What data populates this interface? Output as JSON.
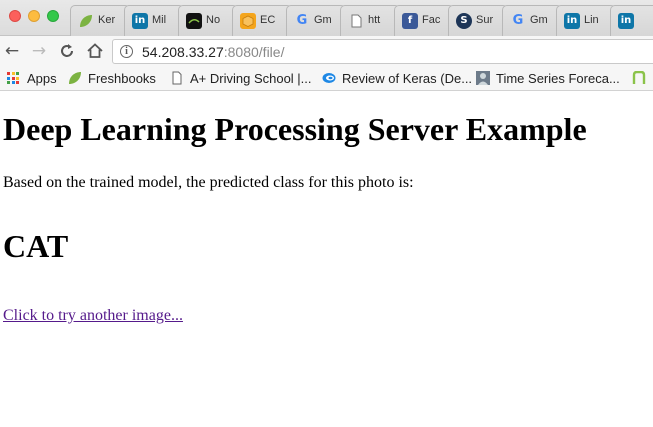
{
  "browser": {
    "tabs": [
      {
        "label": "Ker",
        "icon": "leaf-icon",
        "color": "#6aa84f"
      },
      {
        "label": "Mil",
        "icon": "linkedin-icon",
        "color": "#0e76a8"
      },
      {
        "label": "No",
        "icon": "dark-logo-icon",
        "color": "#111111"
      },
      {
        "label": "EC",
        "icon": "box-icon",
        "color": "#f4a51c"
      },
      {
        "label": "Gm",
        "icon": "google-icon",
        "color": "#4285f4"
      },
      {
        "label": "htt",
        "icon": "page-icon",
        "color": "#999999"
      },
      {
        "label": "Fac",
        "icon": "facebook-icon",
        "color": "#3b5998"
      },
      {
        "label": "Sur",
        "icon": "s-circle-icon",
        "color": "#1d3557"
      },
      {
        "label": "Gm",
        "icon": "google-icon",
        "color": "#4285f4"
      },
      {
        "label": "Lin",
        "icon": "linkedin-icon",
        "color": "#0e76a8"
      },
      {
        "label": "",
        "icon": "linkedin-icon",
        "color": "#0e76a8"
      }
    ],
    "address": {
      "host": "54.208.33.27",
      "rest": ":8080/file/"
    },
    "bookmarks": [
      {
        "label": "Apps",
        "icon": "apps-grid-icon"
      },
      {
        "label": "Freshbooks",
        "icon": "leaf-icon"
      },
      {
        "label": "A+ Driving School |...",
        "icon": "page-icon"
      },
      {
        "label": "Review of Keras (De...",
        "icon": "swirl-icon"
      },
      {
        "label": "Time Series Foreca...",
        "icon": "avatar-icon"
      },
      {
        "label": "",
        "icon": "n-logo-icon"
      }
    ]
  },
  "page": {
    "title": "Deep Learning Processing Server Example",
    "description": "Based on the trained model, the predicted class for this photo is:",
    "prediction": "CAT",
    "link_text": "Click to try another image..."
  }
}
